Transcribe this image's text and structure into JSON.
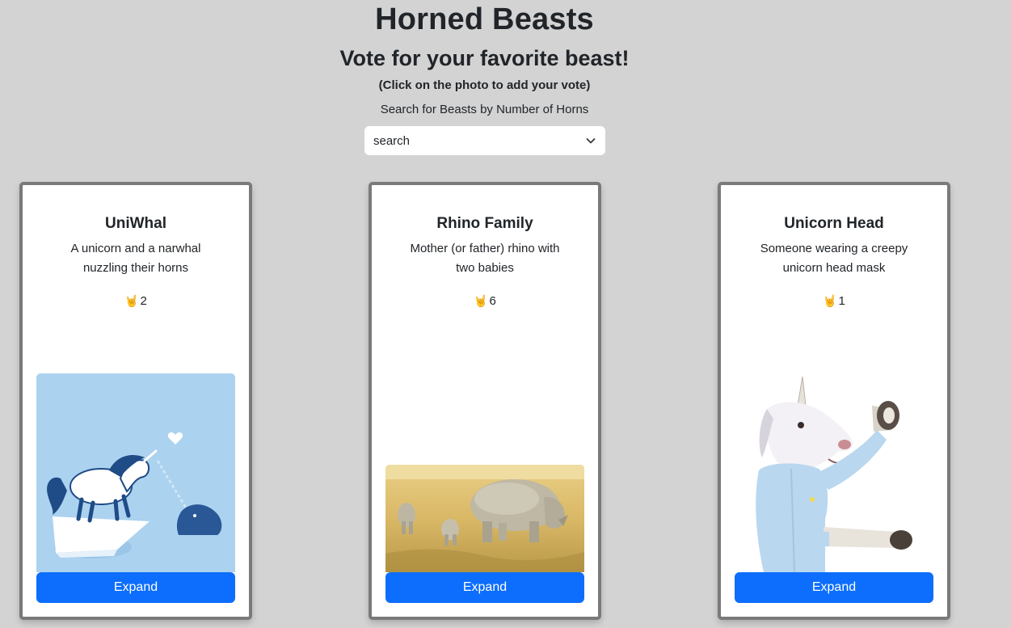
{
  "header": {
    "title": "Horned Beasts",
    "subtitle": "Vote for your favorite beast!",
    "hint": "(Click on the photo to add your vote)",
    "search_label": "Search for Beasts by Number of Horns"
  },
  "search": {
    "selected": "search",
    "icon": "chevron-down-icon"
  },
  "colors": {
    "background": "#d3d3d3",
    "card_border": "#7a7a7a",
    "button": "#0d6efd",
    "horns_icon": "#f2b400"
  },
  "cards": [
    {
      "title": "UniWhal",
      "description": "A unicorn and a narwhal nuzzling their horns",
      "vote_icon": "🤘",
      "votes": "2",
      "image": "unicorn-narwhal-illustration",
      "button": "Expand"
    },
    {
      "title": "Rhino Family",
      "description": "Mother (or father) rhino with two babies",
      "vote_icon": "🤘",
      "votes": "6",
      "image": "rhino-family-photo",
      "button": "Expand"
    },
    {
      "title": "Unicorn Head",
      "description": "Someone wearing a creepy unicorn head mask",
      "vote_icon": "🤘",
      "votes": "1",
      "image": "unicorn-head-mask-photo",
      "button": "Expand"
    }
  ]
}
